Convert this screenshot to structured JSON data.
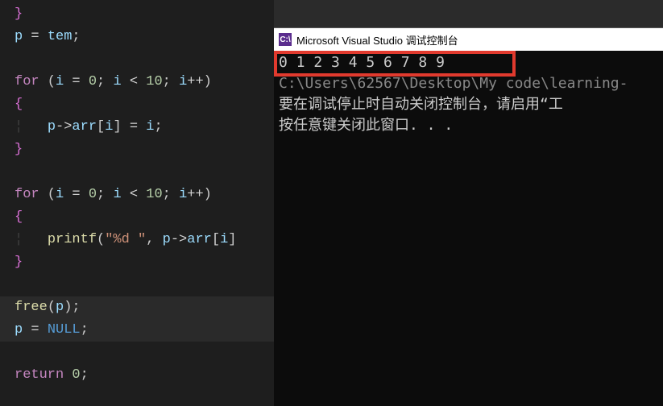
{
  "editor": {
    "lines": {
      "l0_brace": "}",
      "l1_p": "p",
      "l1_eq": " = ",
      "l1_tem": "tem",
      "l1_semi": ";",
      "l3_for": "for",
      "l3_open": " (",
      "l3_i1": "i",
      "l3_eq1": " = ",
      "l3_zero": "0",
      "l3_semi1": "; ",
      "l3_i2": "i",
      "l3_lt": " < ",
      "l3_ten": "10",
      "l3_semi2": "; ",
      "l3_i3": "i",
      "l3_inc": "++",
      "l3_close": ")",
      "l4_brace": "{",
      "l5_p": "p",
      "l5_arrow": "->",
      "l5_arr": "arr",
      "l5_lb": "[",
      "l5_i": "i",
      "l5_rb": "]",
      "l5_eq": " = ",
      "l5_i2": "i",
      "l5_semi": ";",
      "l6_brace": "}",
      "l8_for": "for",
      "l8_open": " (",
      "l8_i1": "i",
      "l8_eq1": " = ",
      "l8_zero": "0",
      "l8_semi1": "; ",
      "l8_i2": "i",
      "l8_lt": " < ",
      "l8_ten": "10",
      "l8_semi2": "; ",
      "l8_i3": "i",
      "l8_inc": "++",
      "l8_close": ")",
      "l9_brace": "{",
      "l10_printf": "printf",
      "l10_open": "(",
      "l10_str": "\"%d \"",
      "l10_comma": ", ",
      "l10_p": "p",
      "l10_arrow": "->",
      "l10_arr": "arr",
      "l10_lb": "[",
      "l10_i": "i",
      "l10_rb": "]",
      "l11_brace": "}",
      "l13_free": "free",
      "l13_open": "(",
      "l13_p": "p",
      "l13_close": ")",
      "l13_semi": ";",
      "l14_p": "p",
      "l14_eq": " = ",
      "l14_null": "NULL",
      "l14_semi": ";",
      "l16_return": "return",
      "l16_sp": " ",
      "l16_zero": "0",
      "l16_semi": ";"
    }
  },
  "console": {
    "title": "Microsoft Visual Studio 调试控制台",
    "icon_text": "C:\\",
    "output_line": "0 1 2 3 4 5 6 7 8 9",
    "path_line": "C:\\Users\\62567\\Desktop\\My code\\learning-",
    "msg1": "要在调试停止时自动关闭控制台，请启用“工",
    "msg2": "按任意键关闭此窗口. . ."
  }
}
